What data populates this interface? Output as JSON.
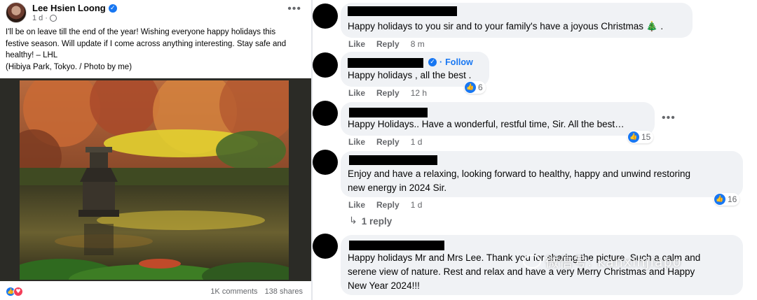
{
  "post": {
    "author": "Lee Hsien Loong",
    "time": "1 d",
    "body": "I'll be on leave till the end of the year! Wishing everyone happy holidays this festive season. Will update if I come across anything interesting. Stay safe and healthy! – LHL",
    "caption": "(Hibiya Park, Tokyo. / Photo by me)",
    "comments_count": "1K comments",
    "shares_count": "138 shares"
  },
  "comments": [
    {
      "text": "Happy holidays to you sir and to your family's have a joyous Christmas",
      "like": "Like",
      "reply": "Reply",
      "time": "8 m"
    },
    {
      "follow": "Follow",
      "text": "Happy holidays , all the best .",
      "like": "Like",
      "reply": "Reply",
      "time": "12 h",
      "reactions": "6"
    },
    {
      "text": "Happy Holidays.. Have a wonderful, restful time, Sir. All the best…",
      "like": "Like",
      "reply": "Reply",
      "time": "1 d",
      "reactions": "15"
    },
    {
      "text_line1": "Enjoy and have a relaxing, looking forward to healthy, happy and unwind restoring",
      "text_line2": "new energy in 2024 Sir.",
      "like": "Like",
      "reply": "Reply",
      "time": "1 d",
      "reactions": "16",
      "replies": "1 reply"
    },
    {
      "text_line1": "Happy holidays Mr and Mrs Lee. Thank you for sharing the picture. Such a calm and",
      "text_line2": "serene view of nature. Rest and relax and have a very Merry Christmas and Happy",
      "text_line3": "New Year 2024!!!"
    }
  ],
  "watermark": "微信号: kanxinjiapo",
  "colors": {
    "link": "#1877f2",
    "bubble": "#f0f2f5",
    "muted": "#65676b"
  }
}
